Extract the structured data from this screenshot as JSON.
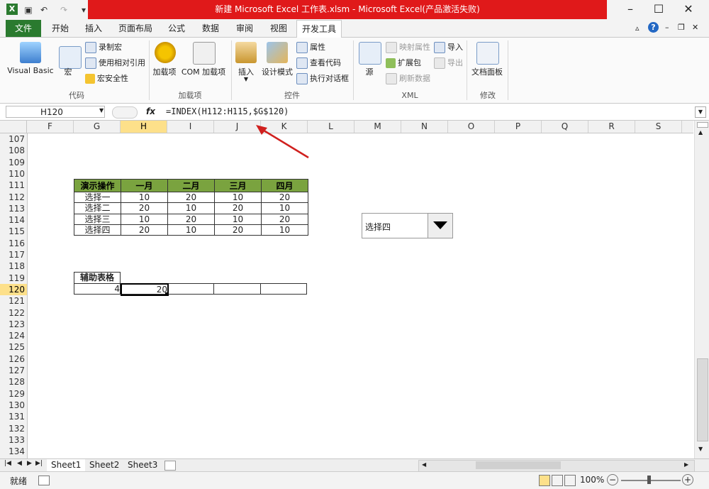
{
  "window": {
    "title": "新建 Microsoft Excel 工作表.xlsm - Microsoft Excel(产品激活失败)",
    "app_icon": "X"
  },
  "tabs": [
    "文件",
    "开始",
    "插入",
    "页面布局",
    "公式",
    "数据",
    "审阅",
    "视图",
    "开发工具"
  ],
  "ribbon": {
    "code": {
      "visual_basic": "Visual Basic",
      "macro": "宏",
      "record": "录制宏",
      "relative": "使用相对引用",
      "security": "宏安全性",
      "label": "代码"
    },
    "addins": {
      "addins": "加载项",
      "com": "COM 加载项",
      "label": "加载项"
    },
    "controls": {
      "insert": "插入",
      "design": "设计模式",
      "props": "属性",
      "viewcode": "查看代码",
      "dialog": "执行对话框",
      "label": "控件"
    },
    "xml": {
      "source": "源",
      "mapprops": "映射属性",
      "import": "导入",
      "expand": "扩展包",
      "export": "导出",
      "refresh": "刷新数据",
      "label": "XML"
    },
    "modify": {
      "docpanel": "文档面板",
      "label": "修改"
    }
  },
  "formula_bar": {
    "name_box": "H120",
    "fx": "fx",
    "formula": "=INDEX(H112:H115,$G$120)"
  },
  "columns": [
    "F",
    "G",
    "H",
    "I",
    "J",
    "K",
    "L",
    "M",
    "N",
    "O",
    "P",
    "Q",
    "R",
    "S"
  ],
  "rows": [
    "107",
    "108",
    "109",
    "110",
    "111",
    "112",
    "113",
    "114",
    "115",
    "116",
    "117",
    "118",
    "119",
    "120",
    "121",
    "122",
    "123",
    "124",
    "125",
    "126",
    "127",
    "128",
    "129",
    "130",
    "131",
    "132",
    "133",
    "134"
  ],
  "main_table": {
    "headers": [
      "演示操作",
      "一月",
      "二月",
      "三月",
      "四月"
    ],
    "rows": [
      [
        "选择一",
        "10",
        "20",
        "10",
        "20"
      ],
      [
        "选择二",
        "20",
        "10",
        "20",
        "10"
      ],
      [
        "选择三",
        "10",
        "20",
        "10",
        "20"
      ],
      [
        "选择四",
        "20",
        "10",
        "20",
        "10"
      ]
    ]
  },
  "aux_table": {
    "header": "辅助表格",
    "g120": "4",
    "h120": "20"
  },
  "dropdown": {
    "value": "选择四"
  },
  "sheets": [
    "Sheet1",
    "Sheet2",
    "Sheet3"
  ],
  "status": {
    "ready": "就绪",
    "zoom": "100%"
  },
  "colors": {
    "accent_green": "#2a7a2f",
    "title_red": "#e0191a",
    "header_green": "#7aa33f",
    "selection": "#fde08a"
  }
}
